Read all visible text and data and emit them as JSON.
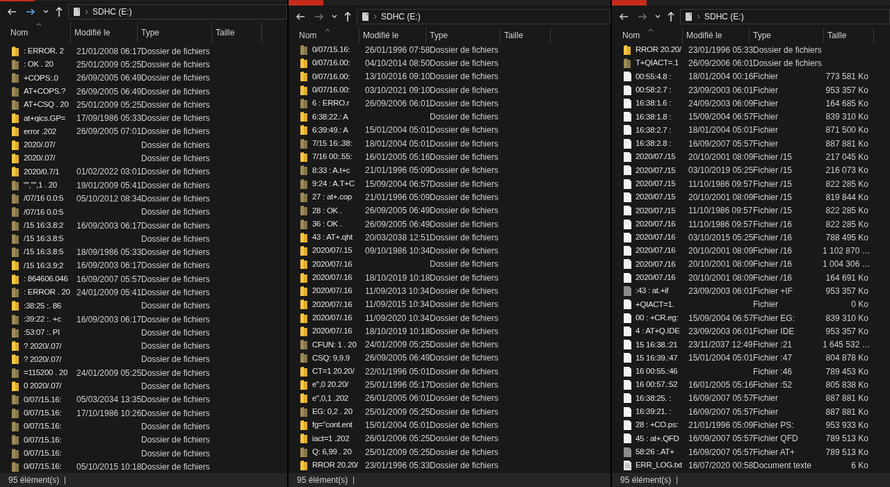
{
  "windows": [
    {
      "address": "SDHC (E:)",
      "forward_enabled": true,
      "columns": [
        "Nom",
        "Modifié le",
        "Type",
        "Taille"
      ],
      "status": "95 élément(s)",
      "rows": [
        {
          "name": ": ERROR. 2",
          "modified": "21/01/2008 06:17",
          "type": "Dossier de fichiers",
          "kind": "folder",
          "hidden": false
        },
        {
          "name": ": OK . 20",
          "modified": "25/01/2009 05:25",
          "type": "Dossier de fichiers",
          "kind": "folder",
          "hidden": true
        },
        {
          "name": "+COPS:.0",
          "modified": "26/09/2005 06:49",
          "type": "Dossier de fichiers",
          "kind": "folder",
          "hidden": true
        },
        {
          "name": "AT+COPS.?",
          "modified": "26/09/2005 06:49",
          "type": "Dossier de fichiers",
          "kind": "folder",
          "hidden": true
        },
        {
          "name": "AT+CSQ . 20",
          "modified": "25/01/2009 05:25",
          "type": "Dossier de fichiers",
          "kind": "folder",
          "hidden": true
        },
        {
          "name": "at+qics.GP=",
          "modified": "17/09/1986 05:33",
          "type": "Dossier de fichiers",
          "kind": "folder",
          "hidden": false
        },
        {
          "name": "error .202",
          "modified": "26/09/2005 07:01",
          "type": "Dossier de fichiers",
          "kind": "folder",
          "hidden": false
        },
        {
          "name": "2020/.07/",
          "type": "Dossier de fichiers",
          "kind": "folder",
          "hidden": false
        },
        {
          "name": "2020/.07/",
          "type": "Dossier de fichiers",
          "kind": "folder",
          "hidden": false
        },
        {
          "name": "2020/0.7/1",
          "modified": "01/02/2022 03:01",
          "type": "Dossier de fichiers",
          "kind": "folder",
          "hidden": false
        },
        {
          "name": "\"\",\"\",1 . 20",
          "modified": "19/01/2009 05:41",
          "type": "Dossier de fichiers",
          "kind": "folder",
          "hidden": true
        },
        {
          "name": "/07/16 0.0:5",
          "modified": "05/10/2012 08:34",
          "type": "Dossier de fichiers",
          "kind": "folder",
          "hidden": true
        },
        {
          "name": "/07/16 0.0:5",
          "type": "Dossier de fichiers",
          "kind": "folder",
          "hidden": true
        },
        {
          "name": "/15 16:3.8:2",
          "modified": "16/09/2003 06:17",
          "type": "Dossier de fichiers",
          "kind": "folder",
          "hidden": true
        },
        {
          "name": "/15 16:3.8:5",
          "type": "Dossier de fichiers",
          "kind": "folder",
          "hidden": true
        },
        {
          "name": "/15 16:3.8:5",
          "modified": "18/09/1986 05:33",
          "type": "Dossier de fichiers",
          "kind": "folder",
          "hidden": true
        },
        {
          "name": "/15 16:3.9:2",
          "modified": "16/09/2003 06:17",
          "type": "Dossier de fichiers",
          "kind": "folder",
          "hidden": false
        },
        {
          "name": ": 864606.046",
          "modified": "16/09/2007 05:57",
          "type": "Dossier de fichiers",
          "kind": "folder",
          "hidden": false
        },
        {
          "name": ": ERROR . 20",
          "modified": "24/01/2009 05:41",
          "type": "Dossier de fichiers",
          "kind": "folder",
          "hidden": true
        },
        {
          "name": ":38:25 :. 86",
          "type": "Dossier de fichiers",
          "kind": "folder",
          "hidden": false
        },
        {
          "name": ":39:22 :. +c",
          "modified": "16/09/2003 06:17",
          "type": "Dossier de fichiers",
          "kind": "folder",
          "hidden": true
        },
        {
          "name": ":53:07 :. PI",
          "type": "Dossier de fichiers",
          "kind": "folder",
          "hidden": true
        },
        {
          "name": "? 2020/.07/",
          "type": "Dossier de fichiers",
          "kind": "folder",
          "hidden": false
        },
        {
          "name": "? 2020/.07/",
          "type": "Dossier de fichiers",
          "kind": "folder",
          "hidden": false
        },
        {
          "name": "=115200 . 20",
          "modified": "24/01/2009 05:25",
          "type": "Dossier de fichiers",
          "kind": "folder",
          "hidden": true
        },
        {
          "name": "0 2020/.07/",
          "type": "Dossier de fichiers",
          "kind": "folder",
          "hidden": false
        },
        {
          "name": "0/07/15.16:",
          "modified": "05/03/2034 13:35",
          "type": "Dossier de fichiers",
          "kind": "folder",
          "hidden": true
        },
        {
          "name": "0/07/15.16:",
          "modified": "17/10/1986 10:26",
          "type": "Dossier de fichiers",
          "kind": "folder",
          "hidden": true
        },
        {
          "name": "0/07/15.16:",
          "type": "Dossier de fichiers",
          "kind": "folder",
          "hidden": true
        },
        {
          "name": "0/07/15.16:",
          "type": "Dossier de fichiers",
          "kind": "folder",
          "hidden": true
        },
        {
          "name": "0/07/15.16:",
          "type": "Dossier de fichiers",
          "kind": "folder",
          "hidden": true
        },
        {
          "name": "0/07/15.16:",
          "modified": "05/10/2015 10:18",
          "type": "Dossier de fichiers",
          "kind": "folder",
          "hidden": true
        }
      ]
    },
    {
      "address": "SDHC (E:)",
      "forward_enabled": false,
      "columns": [
        "Nom",
        "Modifié le",
        "Type",
        "Taille"
      ],
      "status": "95 élément(s)",
      "rows": [
        {
          "name": "0/07/15.16:",
          "modified": "26/01/1996 07:58",
          "type": "Dossier de fichiers",
          "kind": "folder",
          "hidden": true
        },
        {
          "name": "0/07/16.00:",
          "modified": "04/10/2014 08:50",
          "type": "Dossier de fichiers",
          "kind": "folder",
          "hidden": false
        },
        {
          "name": "0/07/16.00:",
          "modified": "13/10/2016 09:10",
          "type": "Dossier de fichiers",
          "kind": "folder",
          "hidden": false
        },
        {
          "name": "0/07/16.00:",
          "modified": "03/10/2021 09:10",
          "type": "Dossier de fichiers",
          "kind": "folder",
          "hidden": false
        },
        {
          "name": "6 : ERRO.r",
          "modified": "26/09/2006 06:01",
          "type": "Dossier de fichiers",
          "kind": "folder",
          "hidden": true
        },
        {
          "name": "6:38:22.: A",
          "type": "Dossier de fichiers",
          "kind": "folder",
          "hidden": false
        },
        {
          "name": "6:39:49.: A",
          "modified": "15/01/2004 05:01",
          "type": "Dossier de fichiers",
          "kind": "folder",
          "hidden": false
        },
        {
          "name": "7/15 16:.38:",
          "modified": "18/01/2004 05:01",
          "type": "Dossier de fichiers",
          "kind": "folder",
          "hidden": true
        },
        {
          "name": "7/16 00:.55:",
          "modified": "16/01/2005 05:16",
          "type": "Dossier de fichiers",
          "kind": "folder",
          "hidden": false
        },
        {
          "name": "8:33 : A.t+c",
          "modified": "21/01/1996 05:09",
          "type": "Dossier de fichiers",
          "kind": "folder",
          "hidden": true
        },
        {
          "name": "9:24 : A.T+C",
          "modified": "15/09/2004 06:57",
          "type": "Dossier de fichiers",
          "kind": "folder",
          "hidden": true
        },
        {
          "name": "27 : at+.cop",
          "modified": "21/01/1996 05:09",
          "type": "Dossier de fichiers",
          "kind": "folder",
          "hidden": true
        },
        {
          "name": "28 : OK .",
          "modified": "26/09/2005 06:49",
          "type": "Dossier de fichiers",
          "kind": "folder",
          "hidden": true
        },
        {
          "name": "36 : OK .",
          "modified": "26/09/2005 06:49",
          "type": "Dossier de fichiers",
          "kind": "folder",
          "hidden": true
        },
        {
          "name": "43 : AT+.qht",
          "modified": "20/03/2038 12:51",
          "type": "Dossier de fichiers",
          "kind": "folder",
          "hidden": false
        },
        {
          "name": "2020/07/.15",
          "modified": "09/10/1986 10:34",
          "type": "Dossier de fichiers",
          "kind": "folder",
          "hidden": false
        },
        {
          "name": "2020/07/.16",
          "type": "Dossier de fichiers",
          "kind": "folder",
          "hidden": false
        },
        {
          "name": "2020/07/.16",
          "modified": "18/10/2019 10:18",
          "type": "Dossier de fichiers",
          "kind": "folder",
          "hidden": false
        },
        {
          "name": "2020/07/.16",
          "modified": "11/09/2013 10:34",
          "type": "Dossier de fichiers",
          "kind": "folder",
          "hidden": false
        },
        {
          "name": "2020/07/.16",
          "modified": "11/09/2015 10:34",
          "type": "Dossier de fichiers",
          "kind": "folder",
          "hidden": false
        },
        {
          "name": "2020/07/.16",
          "modified": "11/09/2020 10:34",
          "type": "Dossier de fichiers",
          "kind": "folder",
          "hidden": false
        },
        {
          "name": "2020/07/.16",
          "modified": "18/10/2019 10:18",
          "type": "Dossier de fichiers",
          "kind": "folder",
          "hidden": false
        },
        {
          "name": "CFUN: 1 . 20",
          "modified": "24/01/2009 05:25",
          "type": "Dossier de fichiers",
          "kind": "folder",
          "hidden": true
        },
        {
          "name": "CSQ: 9,9.9",
          "modified": "26/09/2005 06:49",
          "type": "Dossier de fichiers",
          "kind": "folder",
          "hidden": true
        },
        {
          "name": "CT=1 20.20/",
          "modified": "22/01/1996 05:01",
          "type": "Dossier de fichiers",
          "kind": "folder",
          "hidden": false
        },
        {
          "name": "e\",0 20.20/",
          "modified": "25/01/1996 05:17",
          "type": "Dossier de fichiers",
          "kind": "folder",
          "hidden": false
        },
        {
          "name": "e\",0,1 .202",
          "modified": "26/01/2005 06:01",
          "type": "Dossier de fichiers",
          "kind": "folder",
          "hidden": false
        },
        {
          "name": "EG: 0,2 . 20",
          "modified": "25/01/2009 05:25",
          "type": "Dossier de fichiers",
          "kind": "folder",
          "hidden": true
        },
        {
          "name": "fg=\"cont.ent",
          "modified": "15/01/2004 05:01",
          "type": "Dossier de fichiers",
          "kind": "folder",
          "hidden": false
        },
        {
          "name": "iact=1 .202",
          "modified": "26/01/2006 05:25",
          "type": "Dossier de fichiers",
          "kind": "folder",
          "hidden": false
        },
        {
          "name": "Q: 6,99 . 20",
          "modified": "25/01/2009 05:25",
          "type": "Dossier de fichiers",
          "kind": "folder",
          "hidden": true
        },
        {
          "name": "RROR 20.20/",
          "modified": "23/01/1996 05:33",
          "type": "Dossier de fichiers",
          "kind": "folder",
          "hidden": false
        }
      ]
    },
    {
      "address": "SDHC (E:)",
      "forward_enabled": false,
      "columns": [
        "Nom",
        "Modifié le",
        "Type",
        "Taille"
      ],
      "status": "95 élément(s)",
      "rows": [
        {
          "name": "RROR 20.20/",
          "modified": "23/01/1996 05:33",
          "type": "Dossier de fichiers",
          "kind": "folder",
          "hidden": false
        },
        {
          "name": "T+QIACT=.1",
          "modified": "26/09/2006 06:01",
          "type": "Dossier de fichiers",
          "kind": "folder",
          "hidden": true
        },
        {
          "name": "00:55:4.8 :",
          "modified": "18/01/2004 00:16",
          "type": "Fichier",
          "size": "773 581 Ko",
          "kind": "file",
          "hidden": false
        },
        {
          "name": "00:58:2.7 :",
          "modified": "23/09/2003 06:01",
          "type": "Fichier",
          "size": "953 357 Ko",
          "kind": "file",
          "hidden": false
        },
        {
          "name": "16:38:1.6 :",
          "modified": "24/09/2003 06:09",
          "type": "Fichier",
          "size": "164 685 Ko",
          "kind": "file",
          "hidden": false
        },
        {
          "name": "16:38:1.8 :",
          "modified": "15/09/2004 06:57",
          "type": "Fichier",
          "size": "839 310 Ko",
          "kind": "file",
          "hidden": false
        },
        {
          "name": "16:38:2.7 :",
          "modified": "18/01/2004 05:01",
          "type": "Fichier",
          "size": "871 500 Ko",
          "kind": "file",
          "hidden": false
        },
        {
          "name": "16:38:2.8 :",
          "modified": "16/09/2007 05:57",
          "type": "Fichier",
          "size": "887 881 Ko",
          "kind": "file",
          "hidden": false
        },
        {
          "name": "2020/07./15",
          "modified": "20/10/2001 08:09",
          "type": "Fichier /15",
          "size": "217 045 Ko",
          "kind": "file",
          "hidden": false
        },
        {
          "name": "2020/07./15",
          "modified": "03/10/2019 05:25",
          "type": "Fichier /15",
          "size": "216 073 Ko",
          "kind": "file",
          "hidden": false
        },
        {
          "name": "2020/07./15",
          "modified": "11/10/1986 09:57",
          "type": "Fichier /15",
          "size": "822 285 Ko",
          "kind": "file",
          "hidden": false
        },
        {
          "name": "2020/07./15",
          "modified": "20/10/2001 08:09",
          "type": "Fichier /15",
          "size": "819 844 Ko",
          "kind": "file",
          "hidden": false
        },
        {
          "name": "2020/07./15",
          "modified": "11/10/1986 09:57",
          "type": "Fichier /15",
          "size": "822 285 Ko",
          "kind": "file",
          "hidden": false
        },
        {
          "name": "2020/07./16",
          "modified": "11/10/1986 09:57",
          "type": "Fichier /16",
          "size": "822 285 Ko",
          "kind": "file",
          "hidden": false
        },
        {
          "name": "2020/07./16",
          "modified": "03/10/2015 05:25",
          "type": "Fichier /16",
          "size": "788 495 Ko",
          "kind": "file",
          "hidden": false
        },
        {
          "name": "2020/07./16",
          "modified": "20/10/2001 08:09",
          "type": "Fichier /16",
          "size": "1 102 870 …",
          "kind": "file",
          "hidden": false
        },
        {
          "name": "2020/07./16",
          "modified": "20/10/2001 08:09",
          "type": "Fichier /16",
          "size": "1 004 306 …",
          "kind": "file",
          "hidden": false
        },
        {
          "name": "2020/07./16",
          "modified": "20/10/2001 08:09",
          "type": "Fichier /16",
          "size": "164 691 Ko",
          "kind": "file",
          "hidden": false
        },
        {
          "name": ":43 : at.+if",
          "modified": "23/09/2003 06:01",
          "type": "Fichier +IF",
          "size": "953 357 Ko",
          "kind": "file",
          "hidden": true
        },
        {
          "name": "+QIACT=1.",
          "type": "Fichier",
          "size": "0 Ko",
          "kind": "file",
          "hidden": false
        },
        {
          "name": "00 : +CR.eg:",
          "modified": "15/09/2004 06:57",
          "type": "Fichier EG:",
          "size": "839 310 Ko",
          "kind": "file",
          "hidden": false
        },
        {
          "name": "4 : AT+Q.IDE",
          "modified": "23/09/2003 06:01",
          "type": "Fichier IDE",
          "size": "953 357 Ko",
          "kind": "file",
          "hidden": false
        },
        {
          "name": "15 16:38.:21",
          "modified": "23/11/2037 12:49",
          "type": "Fichier :21",
          "size": "1 645 532 …",
          "kind": "file",
          "hidden": false
        },
        {
          "name": "15 16:39.:47",
          "modified": "15/01/2004 05:01",
          "type": "Fichier :47",
          "size": "804 878 Ko",
          "kind": "file",
          "hidden": false
        },
        {
          "name": "16 00:55.:46",
          "type": "Fichier :46",
          "size": "789 453 Ko",
          "kind": "file",
          "hidden": false
        },
        {
          "name": "16 00:57.:52",
          "modified": "16/01/2005 05:16",
          "type": "Fichier :52",
          "size": "805 838 Ko",
          "kind": "file",
          "hidden": false
        },
        {
          "name": "16:38:25. :",
          "modified": "16/09/2007 05:57",
          "type": "Fichier",
          "size": "887 881 Ko",
          "kind": "file",
          "hidden": false
        },
        {
          "name": "16:39:21. :",
          "modified": "16/09/2007 05:57",
          "type": "Fichier",
          "size": "887 881 Ko",
          "kind": "file",
          "hidden": false
        },
        {
          "name": "28 : +CO.ps:",
          "modified": "21/01/1996 05:09",
          "type": "Fichier PS:",
          "size": "953 933 Ko",
          "kind": "file",
          "hidden": false
        },
        {
          "name": "45 : at+.QFD",
          "modified": "16/09/2007 05:57",
          "type": "Fichier QFD",
          "size": "789 513 Ko",
          "kind": "file",
          "hidden": false
        },
        {
          "name": "58:26 :.AT+",
          "modified": "16/09/2007 05:57",
          "type": "Fichier AT+",
          "size": "789 513 Ko",
          "kind": "file",
          "hidden": true
        },
        {
          "name": "ERR_LOG.txt",
          "modified": "16/07/2020 00:58",
          "type": "Document texte",
          "size": "6 Ko",
          "kind": "text",
          "hidden": false
        }
      ]
    }
  ]
}
